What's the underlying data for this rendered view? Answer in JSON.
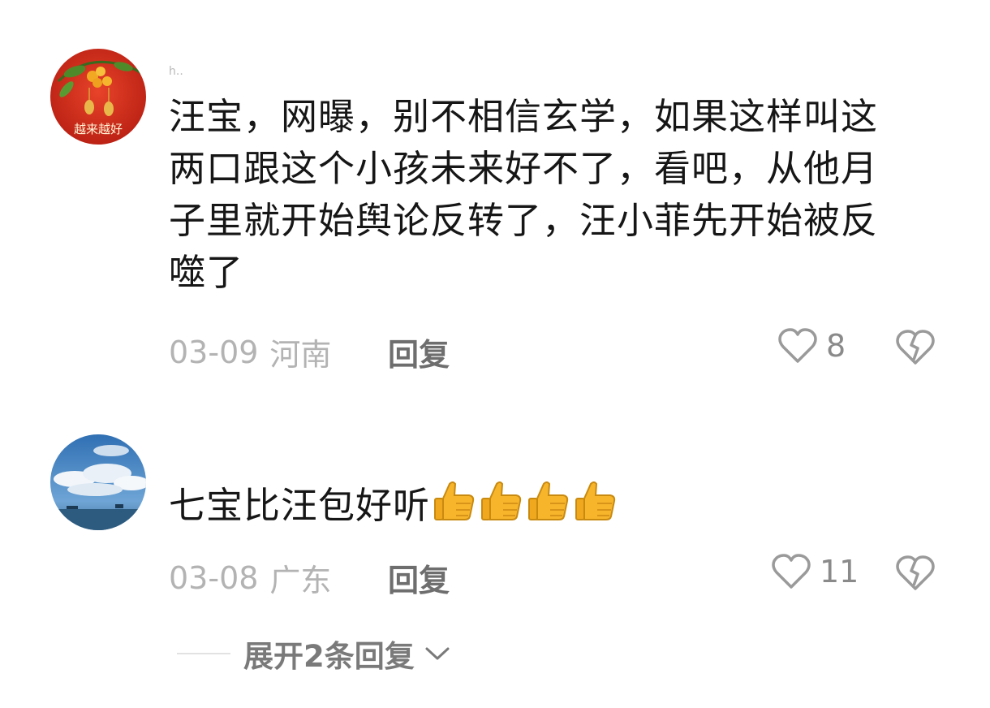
{
  "comments": [
    {
      "username": "h..",
      "avatar_caption": "越来越好",
      "text_lines": [
        "汪宝，网曝，别不相信玄学，如果这样叫这",
        "两口跟这个小孩未来好不了，看吧，从他月",
        "子里就开始舆论反转了，汪小菲先开始被反",
        "噬了"
      ],
      "date": "03-09",
      "region": "河南",
      "reply_label": "回复",
      "like_count": "8"
    },
    {
      "username": "",
      "text": "七宝比汪包好听",
      "emoji": "👍👍👍👍",
      "date": "03-08",
      "region": "广东",
      "reply_label": "回复",
      "like_count": "11"
    }
  ],
  "expand_label": "展开2条回复",
  "icons": {
    "like": "heart-outline-icon",
    "dislike": "broken-heart-icon",
    "expand": "chevron-down-icon"
  },
  "colors": {
    "meta": "#b3b3b3",
    "text": "#161616",
    "reply": "#6e6e6e",
    "thumb": "#f7b52c"
  }
}
